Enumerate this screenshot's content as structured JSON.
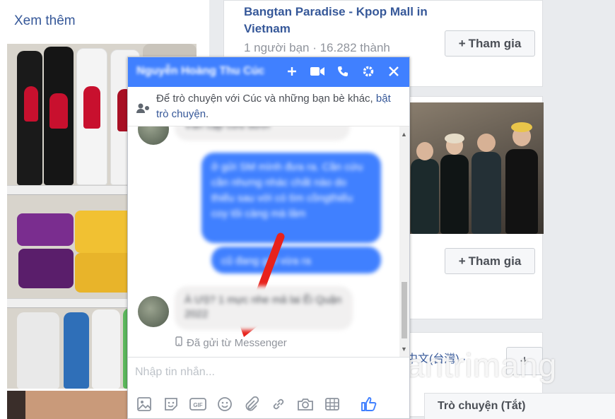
{
  "left": {
    "see_more": "Xem thêm"
  },
  "groups": [
    {
      "name": "Bangtan Paradise - Kpop Mall in Vietnam",
      "meta": "1 người bạn · 16.282 thành",
      "join_label": "Tham gia"
    },
    {
      "join_label": "Tham gia"
    },
    {
      "lang_text": "中文(台灣) ·",
      "plus_label": "+"
    }
  ],
  "chat": {
    "title": "Nguyễn Hoàng Thu Cúc",
    "notice_text": "Để trò chuyện với Cúc và những bạn bè khác, ",
    "notice_link": "bật trò chuyện",
    "notice_end": ".",
    "messages": [
      {
        "dir": "in",
        "text": "Vẫn cập cứu dưới"
      },
      {
        "dir": "out",
        "text": "ở gửi SM mình đưa ra. Cần cứu cần nhưng nhác chất nào do thiếu sau với có tìm cồngthiếu coy tôi càng mà lảm"
      },
      {
        "dir": "out",
        "text": "cũ đang gửi vừa ra"
      },
      {
        "dir": "in",
        "text": "À Ưộ? 1 mực nhe mả lai Ẽi Quận 2022"
      }
    ],
    "sent_from": "Đã gửi từ Messenger",
    "input_placeholder": "Nhập tin nhắn..."
  },
  "footer": {
    "chat_status": "Trò chuyện (Tắt)"
  },
  "watermark": "uantrimang",
  "colors": {
    "messenger_blue": "#4080ff",
    "link_blue": "#365899",
    "annotation_arrow": "#e8221b"
  },
  "icons": [
    "plus-icon",
    "video-icon",
    "phone-icon",
    "gear-icon",
    "close-icon",
    "add-people-icon",
    "phone-small-icon",
    "image-icon",
    "sticker-icon",
    "gif-icon",
    "emoji-icon",
    "attachment-icon",
    "link-icon",
    "camera-icon",
    "table-icon",
    "like-icon"
  ]
}
